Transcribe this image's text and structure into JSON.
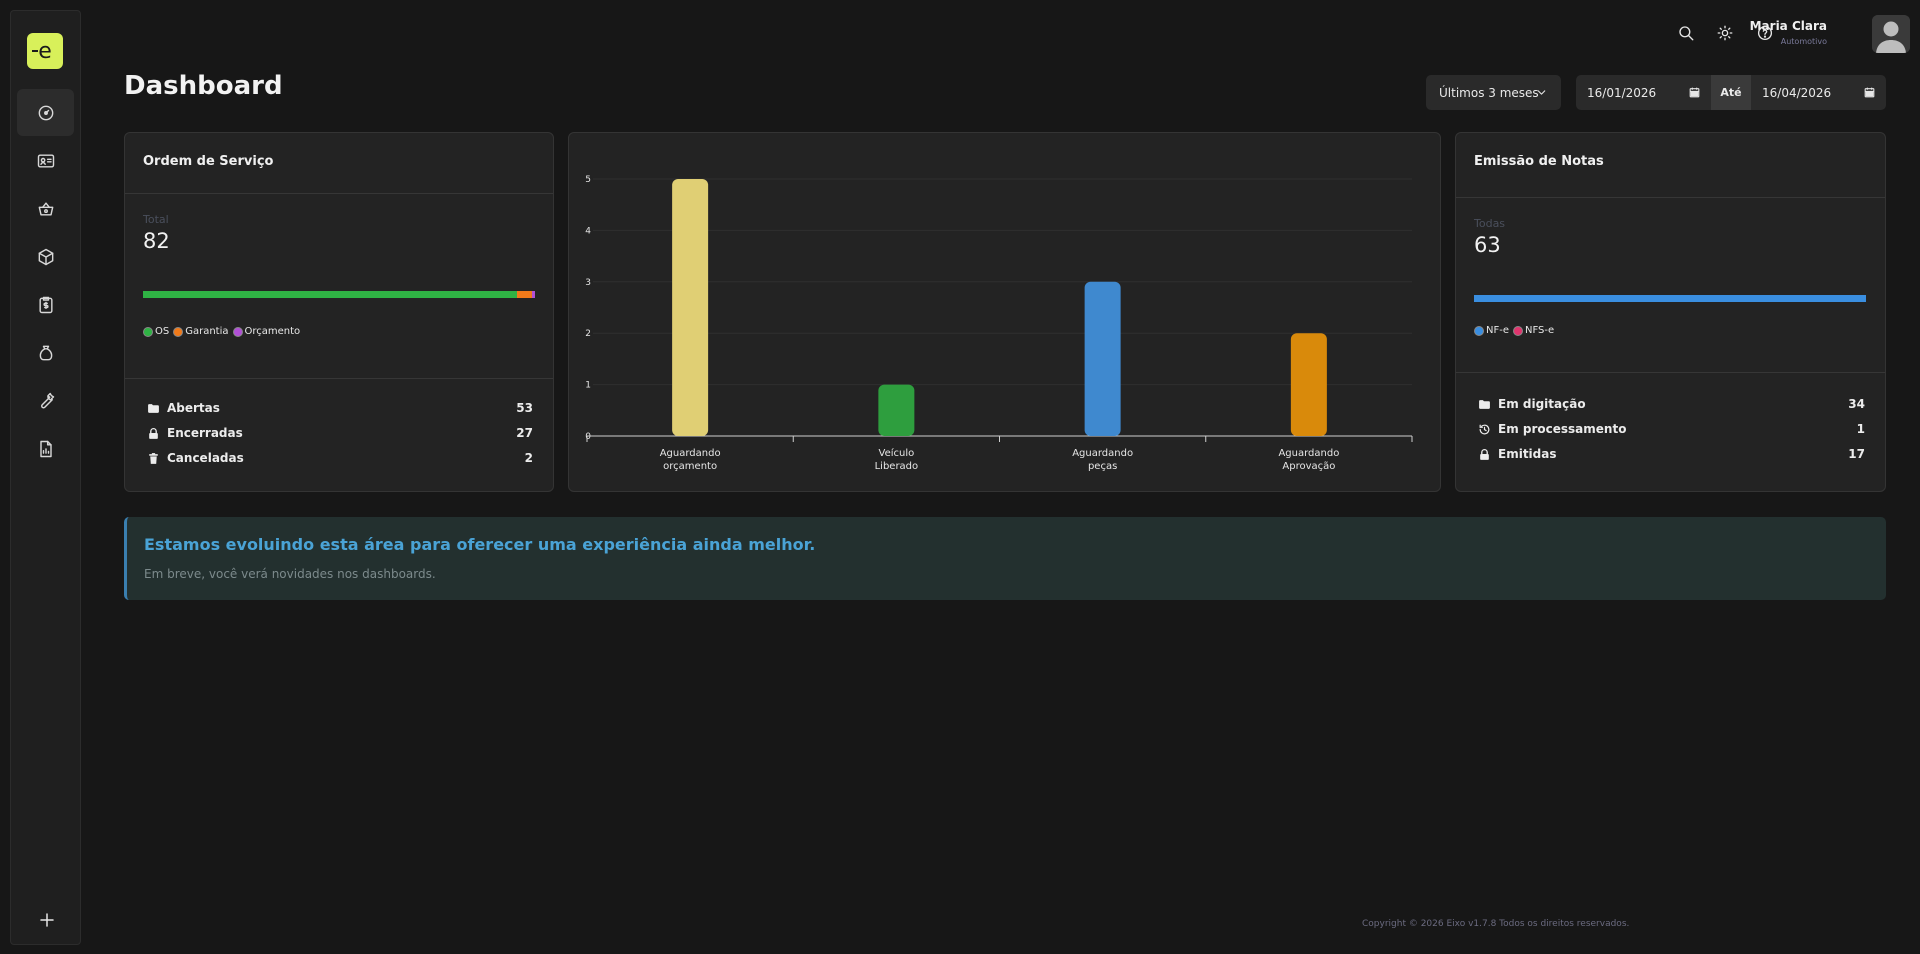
{
  "app": {
    "logo_letter": "e",
    "accent": "#d8f05a"
  },
  "sidebar": {
    "items": [
      {
        "icon": "gauge-icon",
        "active": true
      },
      {
        "icon": "id-card-icon",
        "active": false
      },
      {
        "icon": "basket-icon",
        "active": false
      },
      {
        "icon": "box-icon",
        "active": false
      },
      {
        "icon": "invoice-icon",
        "active": false
      },
      {
        "icon": "money-bag-icon",
        "active": false
      },
      {
        "icon": "wrench-icon",
        "active": false
      },
      {
        "icon": "report-icon",
        "active": false
      }
    ],
    "add_icon": "plus-icon"
  },
  "header": {
    "icons": [
      "search-icon",
      "sun-icon",
      "help-icon"
    ],
    "user_name": "Maria Clara",
    "user_role": "Automotivo"
  },
  "page": {
    "title": "Dashboard"
  },
  "filters": {
    "period": "Últimos 3 meses",
    "date_from": "16/01/2026",
    "separator": "Até",
    "date_to": "16/04/2026"
  },
  "service_orders": {
    "title": "Ordem de Serviço",
    "total_label": "Total",
    "total_value": "82",
    "bar_colors": {
      "os": "#2fb344",
      "garantia": "#f07a1a",
      "orcamento": "#b14fd6"
    },
    "legend": [
      {
        "label": "OS",
        "color": "#2fb344"
      },
      {
        "label": "Garantia",
        "color": "#f07a1a"
      },
      {
        "label": "Orçamento",
        "color": "#b14fd6"
      }
    ],
    "stats": [
      {
        "icon": "folder-icon",
        "label": "Abertas",
        "value": "53"
      },
      {
        "icon": "lock-icon",
        "label": "Encerradas",
        "value": "27"
      },
      {
        "icon": "trash-icon",
        "label": "Canceladas",
        "value": "2"
      }
    ]
  },
  "chart_data": {
    "type": "bar",
    "categories": [
      [
        "Aguardando",
        "orçamento"
      ],
      [
        "Veículo",
        "Liberado"
      ],
      [
        "Aguardando",
        "peças"
      ],
      [
        "Aguardando",
        "Aprovação"
      ]
    ],
    "values": [
      5,
      1,
      3,
      2
    ],
    "colors": [
      "#e0cf74",
      "#2e9e3e",
      "#3f89cf",
      "#d98a0b"
    ],
    "yticks": [
      0,
      1,
      2,
      3,
      4,
      5
    ],
    "ylim": [
      0,
      5
    ],
    "grid": true
  },
  "invoices": {
    "title": "Emissão de Notas",
    "total_label": "Todas",
    "total_value": "63",
    "bar_color": "#3a8ee0",
    "legend": [
      {
        "label": "NF-e",
        "color": "#3a8ee0"
      },
      {
        "label": "NFS-e",
        "color": "#e0356e"
      }
    ],
    "stats": [
      {
        "icon": "folder-icon",
        "label": "Em digitação",
        "value": "34"
      },
      {
        "icon": "history-icon",
        "label": "Em processamento",
        "value": "1"
      },
      {
        "icon": "lock-icon",
        "label": "Emitidas",
        "value": "17"
      }
    ]
  },
  "notice": {
    "title": "Estamos evoluindo esta área para oferecer uma experiência ainda melhor.",
    "text": "Em breve, você verá novidades nos dashboards."
  },
  "footer": {
    "text": "Copyright © 2026 Eixo v1.7.8 Todos os direitos reservados."
  }
}
